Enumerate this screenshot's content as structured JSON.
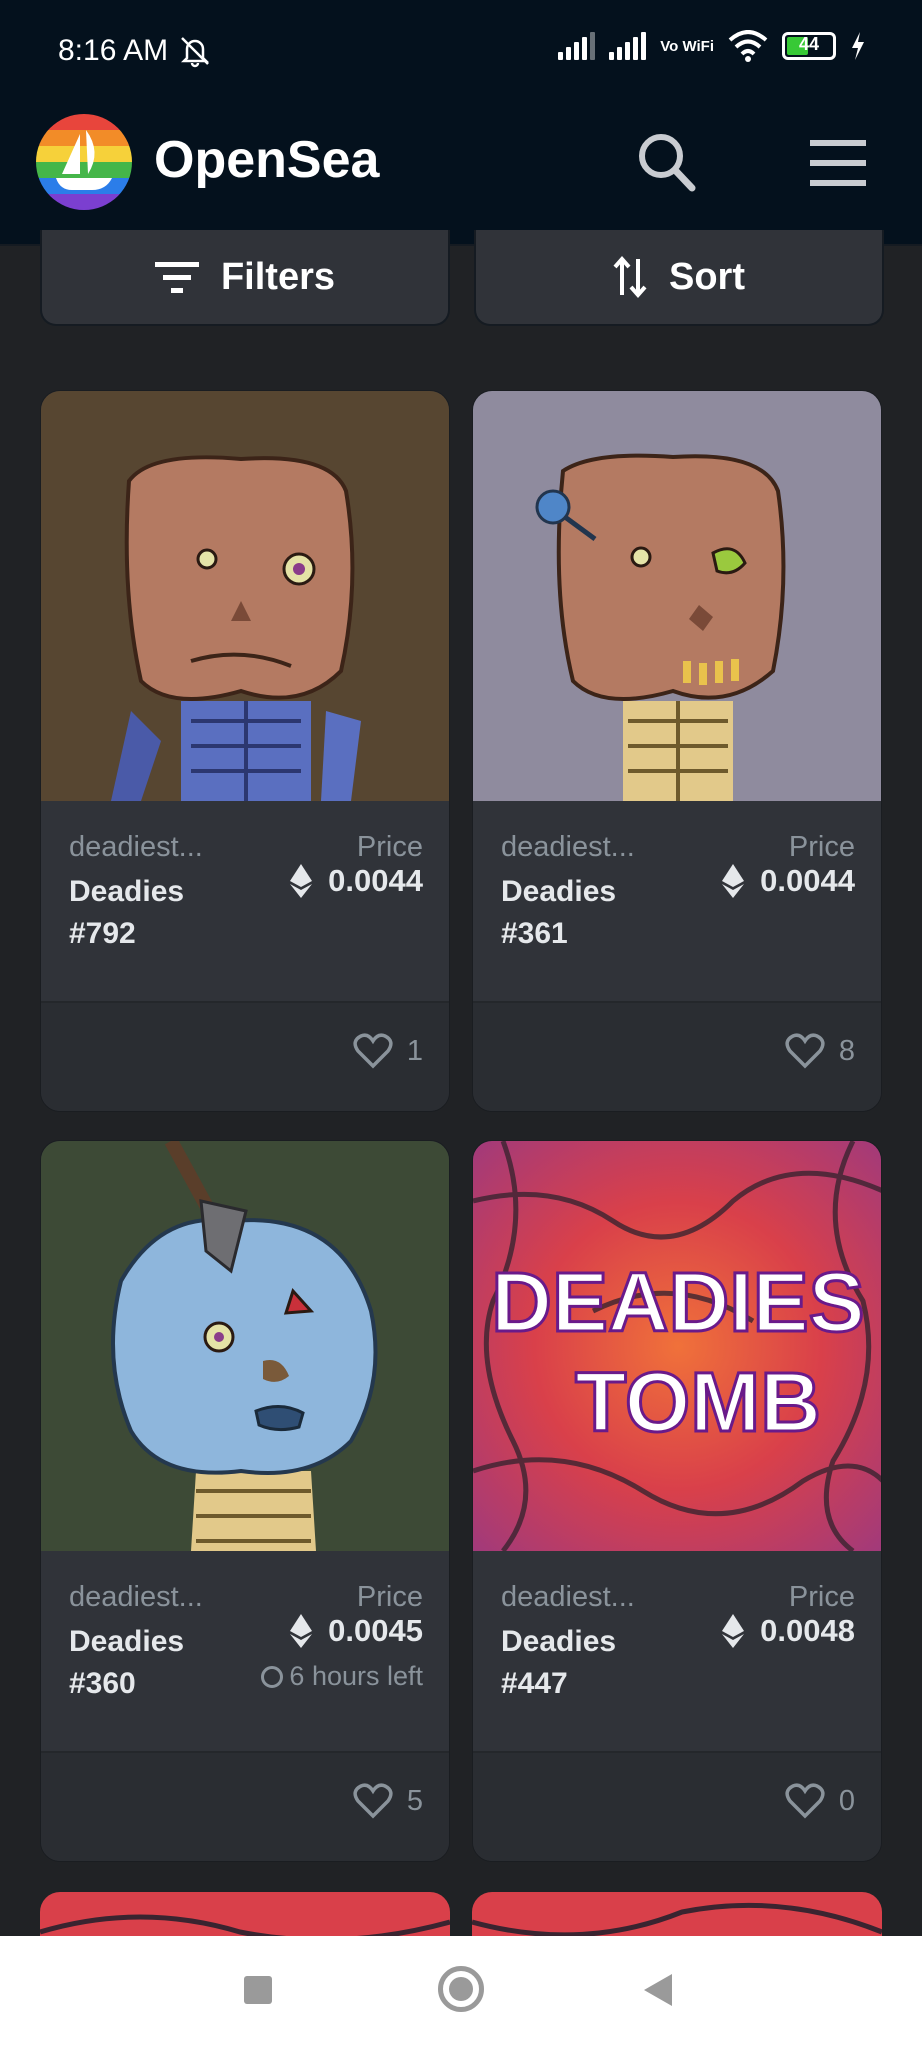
{
  "status_bar": {
    "time": "8:16 AM",
    "network_label": "Vo WiFi",
    "battery": "44"
  },
  "header": {
    "brand": "OpenSea"
  },
  "toolbar": {
    "filters_label": "Filters",
    "sort_label": "Sort"
  },
  "items": [
    {
      "collection": "deadiest...",
      "name": "Deadies",
      "number": "#792",
      "price_label": "Price",
      "price": "0.0044",
      "time_left": "",
      "likes": "1",
      "image_bg": "#574631"
    },
    {
      "collection": "deadiest...",
      "name": "Deadies",
      "number": "#361",
      "price_label": "Price",
      "price": "0.0044",
      "time_left": "",
      "likes": "8",
      "image_bg": "#8f8b9e"
    },
    {
      "collection": "deadiest...",
      "name": "Deadies",
      "number": "#360",
      "price_label": "Price",
      "price": "0.0045",
      "time_left": "6 hours left",
      "likes": "5",
      "image_bg": "#3d4a36"
    },
    {
      "collection": "deadiest...",
      "name": "Deadies",
      "number": "#447",
      "price_label": "Price",
      "price": "0.0048",
      "time_left": "",
      "likes": "0",
      "image_bg": "#c93b4a"
    }
  ],
  "tomb_text": {
    "line1": "DEADIES",
    "line2": "TOMB"
  },
  "colors": {
    "header_bg": "#04111d",
    "card_bg": "#303339",
    "page_bg": "#202225",
    "text": "#e5e8eb",
    "muted": "#8a939b"
  }
}
